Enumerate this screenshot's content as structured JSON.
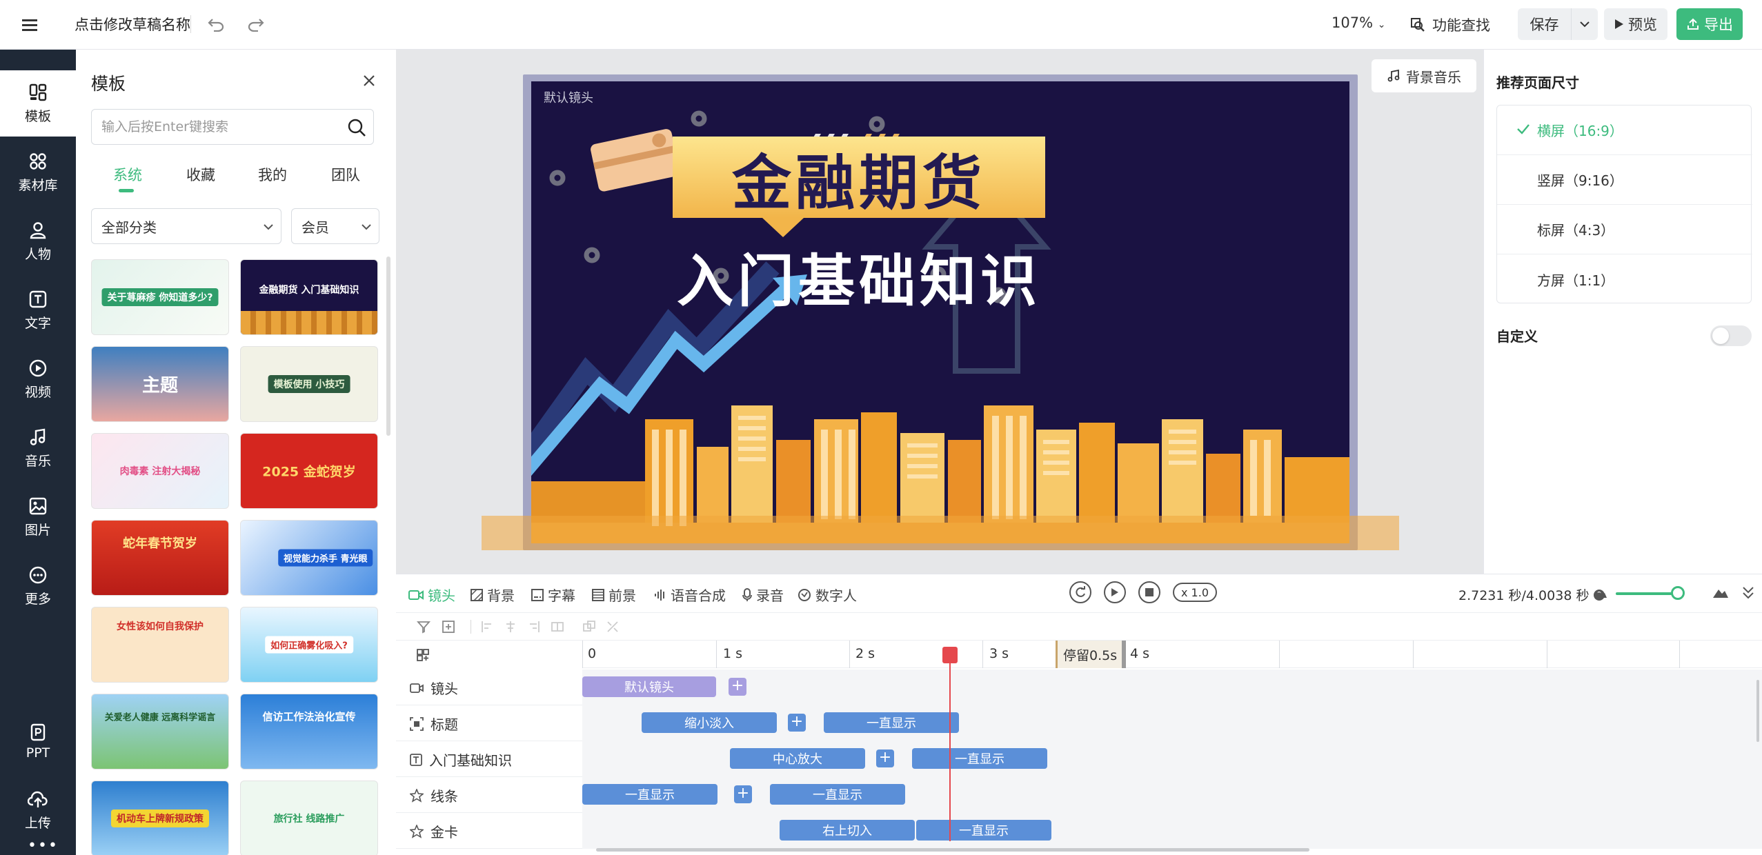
{
  "topbar": {
    "menu_icon": "hamburger-icon",
    "draft_name": "点击修改草稿名称",
    "zoom": "107%",
    "find_label": "功能查找",
    "save_label": "保存",
    "preview_label": "预览",
    "export_label": "导出",
    "accent_color": "#3dbb7e"
  },
  "leftnav": {
    "items": [
      {
        "label": "模板",
        "icon": "template-icon"
      },
      {
        "label": "素材库",
        "icon": "material-icon"
      },
      {
        "label": "人物",
        "icon": "person-icon"
      },
      {
        "label": "文字",
        "icon": "text-icon"
      },
      {
        "label": "视频",
        "icon": "video-icon"
      },
      {
        "label": "音乐",
        "icon": "music-icon"
      },
      {
        "label": "图片",
        "icon": "image-icon"
      },
      {
        "label": "更多",
        "icon": "more-icon"
      },
      {
        "label": "PPT",
        "icon": "ppt-icon"
      },
      {
        "label": "上传",
        "icon": "upload-icon"
      }
    ]
  },
  "panel": {
    "title": "模板",
    "search_placeholder": "输入后按Enter键搜索",
    "tabs": [
      "系统",
      "收藏",
      "我的",
      "团队"
    ],
    "active_tab": "系统",
    "category_select": "全部分类",
    "member_select": "会员",
    "thumbs": [
      {
        "label": "关于荨麻疹 你知道多少?"
      },
      {
        "label": "金融期货 入门基础知识"
      },
      {
        "label": "主题"
      },
      {
        "label": "模板使用 小技巧"
      },
      {
        "label": "肉毒素 注射大揭秘"
      },
      {
        "label": "2025 金蛇贺岁"
      },
      {
        "label": "蛇年春节贺岁"
      },
      {
        "label": "视觉能力杀手 青光眼"
      },
      {
        "label": "女性该如何自我保护"
      },
      {
        "label": "如何正确雾化吸入?"
      },
      {
        "label": "关爱老人健康 远离科学谣言"
      },
      {
        "label": "信访工作法治化宣传"
      },
      {
        "label": "机动车上牌新规政策"
      },
      {
        "label": "旅行社 线路推广"
      }
    ]
  },
  "canvas": {
    "bgm_label": "背景音乐",
    "lens_label": "默认镜头",
    "title_main": "金融期货",
    "title_sub": "入门基础知识"
  },
  "rightpanel": {
    "title": "推荐页面尺寸",
    "sizes": [
      "横屏（16:9）",
      "竖屏（9:16）",
      "标屏（4:3）",
      "方屏（1:1）"
    ],
    "active_size": "横屏（16:9）",
    "custom_label": "自定义",
    "custom_enabled": false
  },
  "timeline": {
    "tabs": [
      "镜头",
      "背景",
      "字幕",
      "前景",
      "语音合成",
      "录音",
      "数字人"
    ],
    "active_tab": "镜头",
    "speed": "x 1.0",
    "time_readout": "2.7231 秒/4.0038 秒",
    "ruler_ticks": [
      "0",
      "1 s",
      "2 s",
      "3 s",
      "4 s"
    ],
    "pause_label": "停留0.5s",
    "tracks": [
      {
        "name": "镜头",
        "icon": "camera-icon",
        "clips": [
          "默认镜头"
        ]
      },
      {
        "name": "标题",
        "icon": "title-icon",
        "clips": [
          "缩小淡入",
          "一直显示"
        ]
      },
      {
        "name": "入门基础知识",
        "icon": "text-box-icon",
        "clips": [
          "中心放大",
          "一直显示"
        ]
      },
      {
        "name": "线条",
        "icon": "star-icon",
        "clips": [
          "一直显示",
          "一直显示"
        ]
      },
      {
        "name": "金卡",
        "icon": "star-icon",
        "clips": [
          "右上切入",
          "一直显示"
        ]
      }
    ],
    "playhead_seconds": 2.7231,
    "total_seconds": 4.0038
  }
}
